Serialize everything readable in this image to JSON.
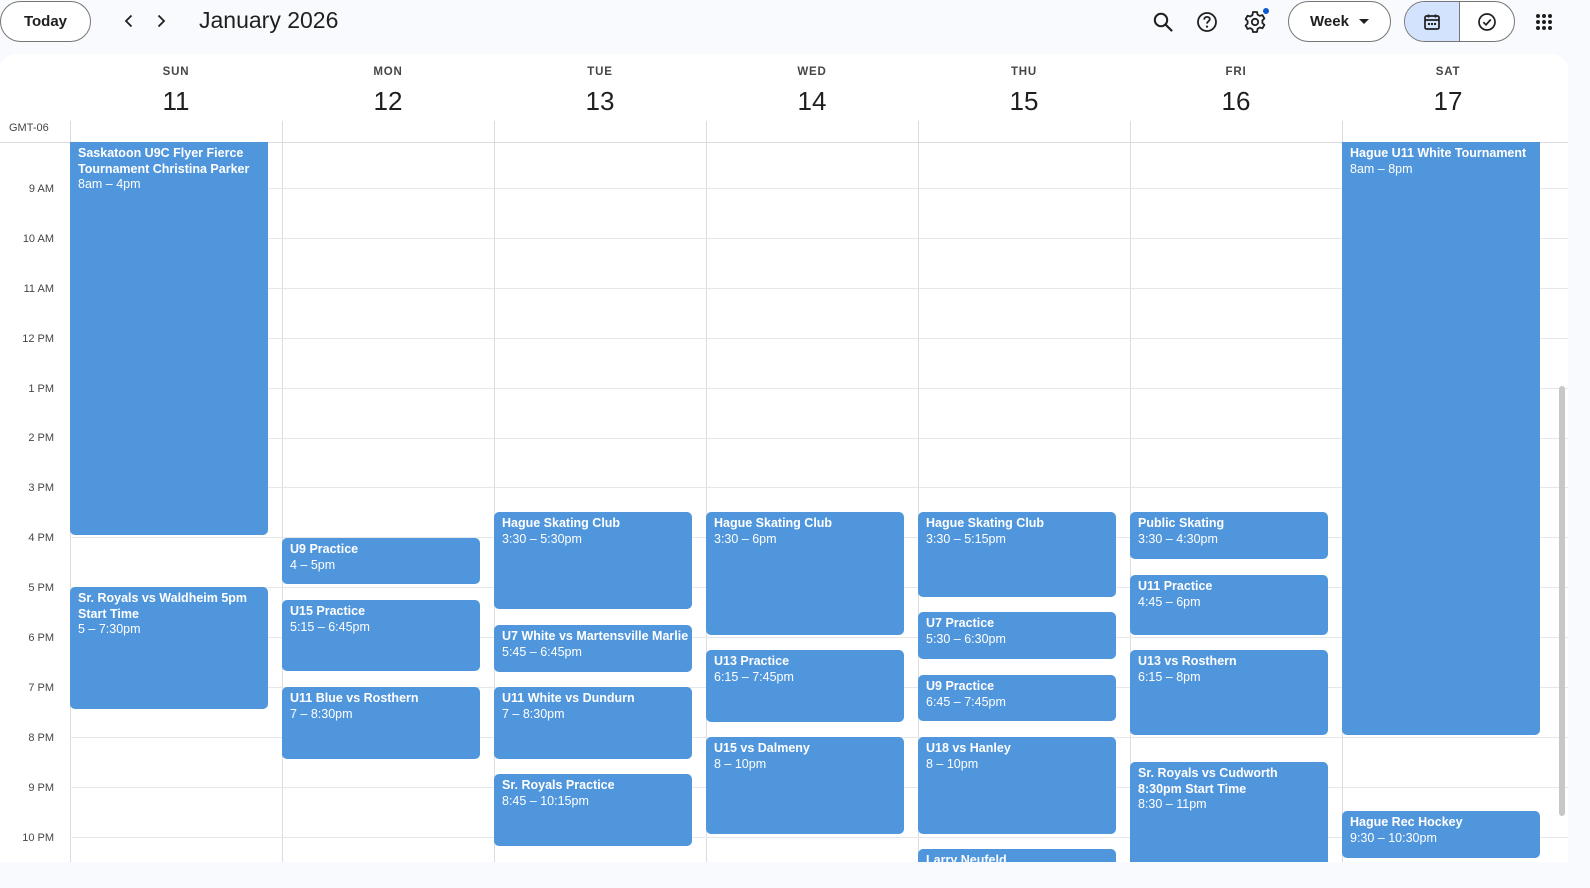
{
  "toolbar": {
    "today_label": "Today",
    "title": "January 2026",
    "view_label": "Week"
  },
  "header": {
    "timezone": "GMT-06",
    "days": [
      {
        "dow": "SUN",
        "num": "11"
      },
      {
        "dow": "MON",
        "num": "12"
      },
      {
        "dow": "TUE",
        "num": "13"
      },
      {
        "dow": "WED",
        "num": "14"
      },
      {
        "dow": "THU",
        "num": "15"
      },
      {
        "dow": "FRI",
        "num": "16"
      },
      {
        "dow": "SAT",
        "num": "17"
      }
    ]
  },
  "time_labels": [
    "9 AM",
    "10 AM",
    "11 AM",
    "12 PM",
    "1 PM",
    "2 PM",
    "3 PM",
    "4 PM",
    "5 PM",
    "6 PM",
    "7 PM",
    "8 PM",
    "9 PM",
    "10 PM"
  ],
  "events": [
    {
      "title": "Saskatoon U9C Flyer Fierce Tournament Christina Parker",
      "time": "8am – 4pm"
    },
    {
      "title": "Sr. Royals vs Waldheim 5pm Start Time",
      "time": "5 – 7:30pm"
    },
    {
      "title": "U9 Practice",
      "time": "4 – 5pm"
    },
    {
      "title": "U15 Practice",
      "time": "5:15 – 6:45pm"
    },
    {
      "title": "U11 Blue vs Rosthern",
      "time": "7 – 8:30pm"
    },
    {
      "title": "Hague Skating Club",
      "time": "3:30 – 5:30pm"
    },
    {
      "title": "U7 White vs Martensville Marlie",
      "time": "5:45 – 6:45pm"
    },
    {
      "title": "U11 White vs Dundurn",
      "time": "7 – 8:30pm"
    },
    {
      "title": "Sr. Royals Practice",
      "time": "8:45 – 10:15pm"
    },
    {
      "title": "Hague Skating Club",
      "time": "3:30 – 6pm"
    },
    {
      "title": "U13 Practice",
      "time": "6:15 – 7:45pm"
    },
    {
      "title": "U15 vs Dalmeny",
      "time": "8 – 10pm"
    },
    {
      "title": "Hague Skating Club",
      "time": "3:30 – 5:15pm"
    },
    {
      "title": "U7 Practice",
      "time": "5:30 – 6:30pm"
    },
    {
      "title": "U9 Practice",
      "time": "6:45 – 7:45pm"
    },
    {
      "title": "U18 vs Hanley",
      "time": "8 – 10pm"
    },
    {
      "title": "Larry Neufeld",
      "time": ""
    },
    {
      "title": "Public Skating",
      "time": "3:30 – 4:30pm"
    },
    {
      "title": "U11 Practice",
      "time": "4:45 – 6pm"
    },
    {
      "title": "U13 vs Rosthern",
      "time": "6:15 – 8pm"
    },
    {
      "title": "Sr. Royals vs Cudworth 8:30pm Start Time",
      "time": "8:30 – 11pm"
    },
    {
      "title": "Hague U11 White Tournament",
      "time": "8am – 8pm"
    },
    {
      "title": "Hague Rec Hockey",
      "time": "9:30 – 10:30pm"
    }
  ]
}
